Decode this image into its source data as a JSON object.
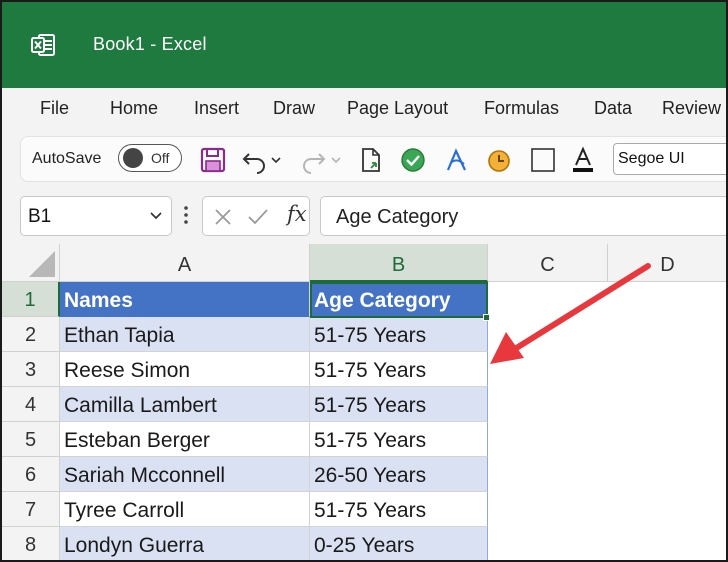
{
  "window": {
    "title": "Book1  -  Excel"
  },
  "menu": [
    "File",
    "Home",
    "Insert",
    "Draw",
    "Page Layout",
    "Formulas",
    "Data",
    "Review"
  ],
  "toolbar": {
    "autosave_label": "AutoSave",
    "autosave_state": "Off",
    "font_name": "Segoe UI"
  },
  "formula_bar": {
    "name_box": "B1",
    "fx_label": "fx",
    "content": "Age Category"
  },
  "columns": [
    "A",
    "B",
    "C",
    "D"
  ],
  "rows": [
    "1",
    "2",
    "3",
    "4",
    "5",
    "6",
    "7",
    "8"
  ],
  "table": {
    "headers": [
      "Names",
      "Age Category"
    ],
    "rows": [
      [
        "Ethan Tapia",
        "51-75 Years"
      ],
      [
        "Reese Simon",
        "51-75 Years"
      ],
      [
        "Camilla Lambert",
        "51-75 Years"
      ],
      [
        "Esteban Berger",
        "51-75 Years"
      ],
      [
        "Sariah Mcconnell",
        "26-50 Years"
      ],
      [
        "Tyree Carroll",
        "51-75 Years"
      ],
      [
        "Londyn Guerra",
        "0-25 Years"
      ]
    ]
  },
  "colors": {
    "title_bar": "#1f7a3f",
    "table_header": "#4472c4",
    "table_band": "#d9e1f2",
    "annotation_arrow": "#e8383d"
  }
}
